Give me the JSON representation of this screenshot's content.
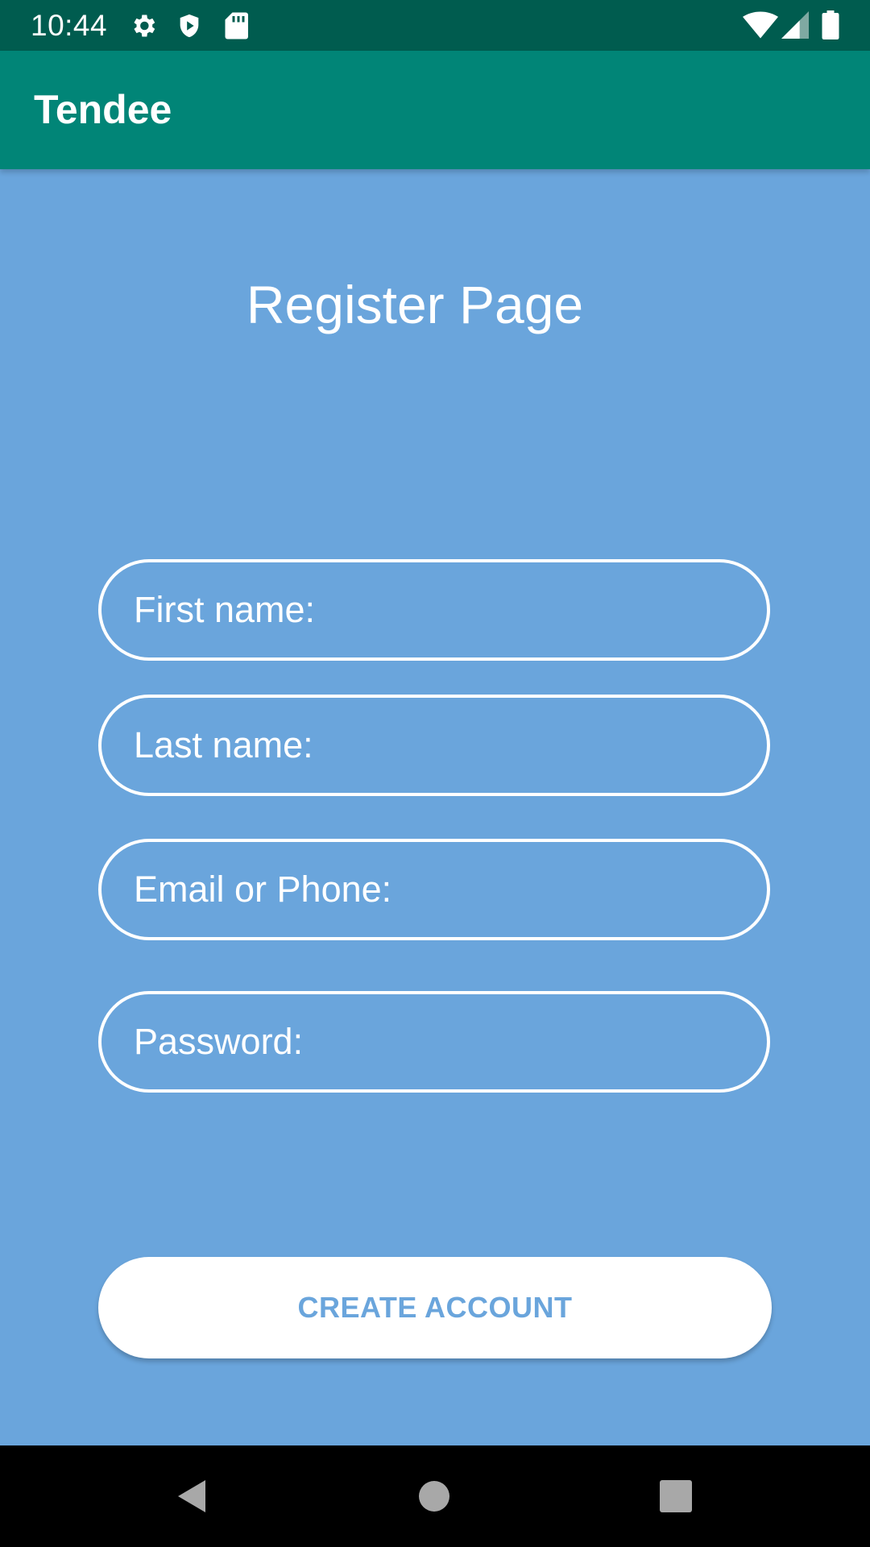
{
  "status_bar": {
    "time": "10:44",
    "icons": [
      "gear-icon",
      "shield-icon",
      "sd-card-icon",
      "wifi-icon",
      "signal-icon",
      "battery-icon"
    ]
  },
  "app_bar": {
    "title": "Tendee"
  },
  "main": {
    "heading": "Register Page",
    "fields": [
      {
        "name": "first-name",
        "value": "",
        "placeholder": "First name:"
      },
      {
        "name": "last-name",
        "value": "",
        "placeholder": "Last name:"
      },
      {
        "name": "email-or-phone",
        "value": "",
        "placeholder": "Email or Phone:"
      },
      {
        "name": "password",
        "value": "",
        "placeholder": "Password:"
      }
    ],
    "create_button_label": "CREATE ACCOUNT"
  },
  "nav_bar": {
    "icons": [
      "back-icon",
      "home-icon",
      "recents-icon"
    ]
  },
  "colors": {
    "status_bar": "#005c4f",
    "app_bar": "#018577",
    "background": "#6aa5dc",
    "button": "#ffffff",
    "button_text": "#6aa5dc"
  }
}
